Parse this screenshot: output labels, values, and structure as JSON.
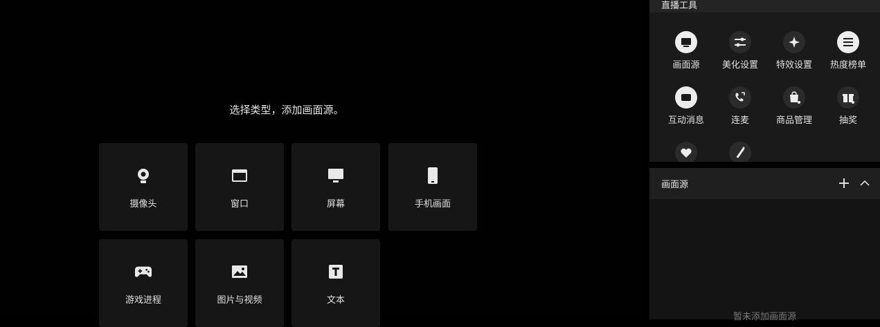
{
  "stage": {
    "prompt": "选择类型，添加画面源。",
    "tiles": [
      {
        "label": "摄像头",
        "icon": "camera-icon"
      },
      {
        "label": "窗口",
        "icon": "window-icon"
      },
      {
        "label": "屏幕",
        "icon": "monitor-icon"
      },
      {
        "label": "手机画面",
        "icon": "phone-icon"
      },
      {
        "label": "游戏进程",
        "icon": "gamepad-icon"
      },
      {
        "label": "图片与视频",
        "icon": "image-icon"
      },
      {
        "label": "文本",
        "icon": "text-icon"
      }
    ]
  },
  "tools": {
    "title": "直播工具",
    "items": [
      {
        "label": "画面源",
        "icon": "source-icon"
      },
      {
        "label": "美化设置",
        "icon": "sliders-icon"
      },
      {
        "label": "特效设置",
        "icon": "sparkle-icon"
      },
      {
        "label": "热度榜单",
        "icon": "list-icon"
      },
      {
        "label": "互动消息",
        "icon": "message-icon"
      },
      {
        "label": "连麦",
        "icon": "phone-call-icon"
      },
      {
        "label": "商品管理",
        "icon": "bag-icon"
      },
      {
        "label": "抽奖",
        "icon": "gift-icon"
      },
      {
        "label": "",
        "icon": "heart-icon"
      },
      {
        "label": "",
        "icon": "magic-wand-icon"
      }
    ]
  },
  "sources": {
    "title": "画面源",
    "empty_text": "暂未添加画面源"
  },
  "colors": {
    "background": "#000000",
    "tile": "#161616",
    "panel": "#1a1a1a"
  }
}
